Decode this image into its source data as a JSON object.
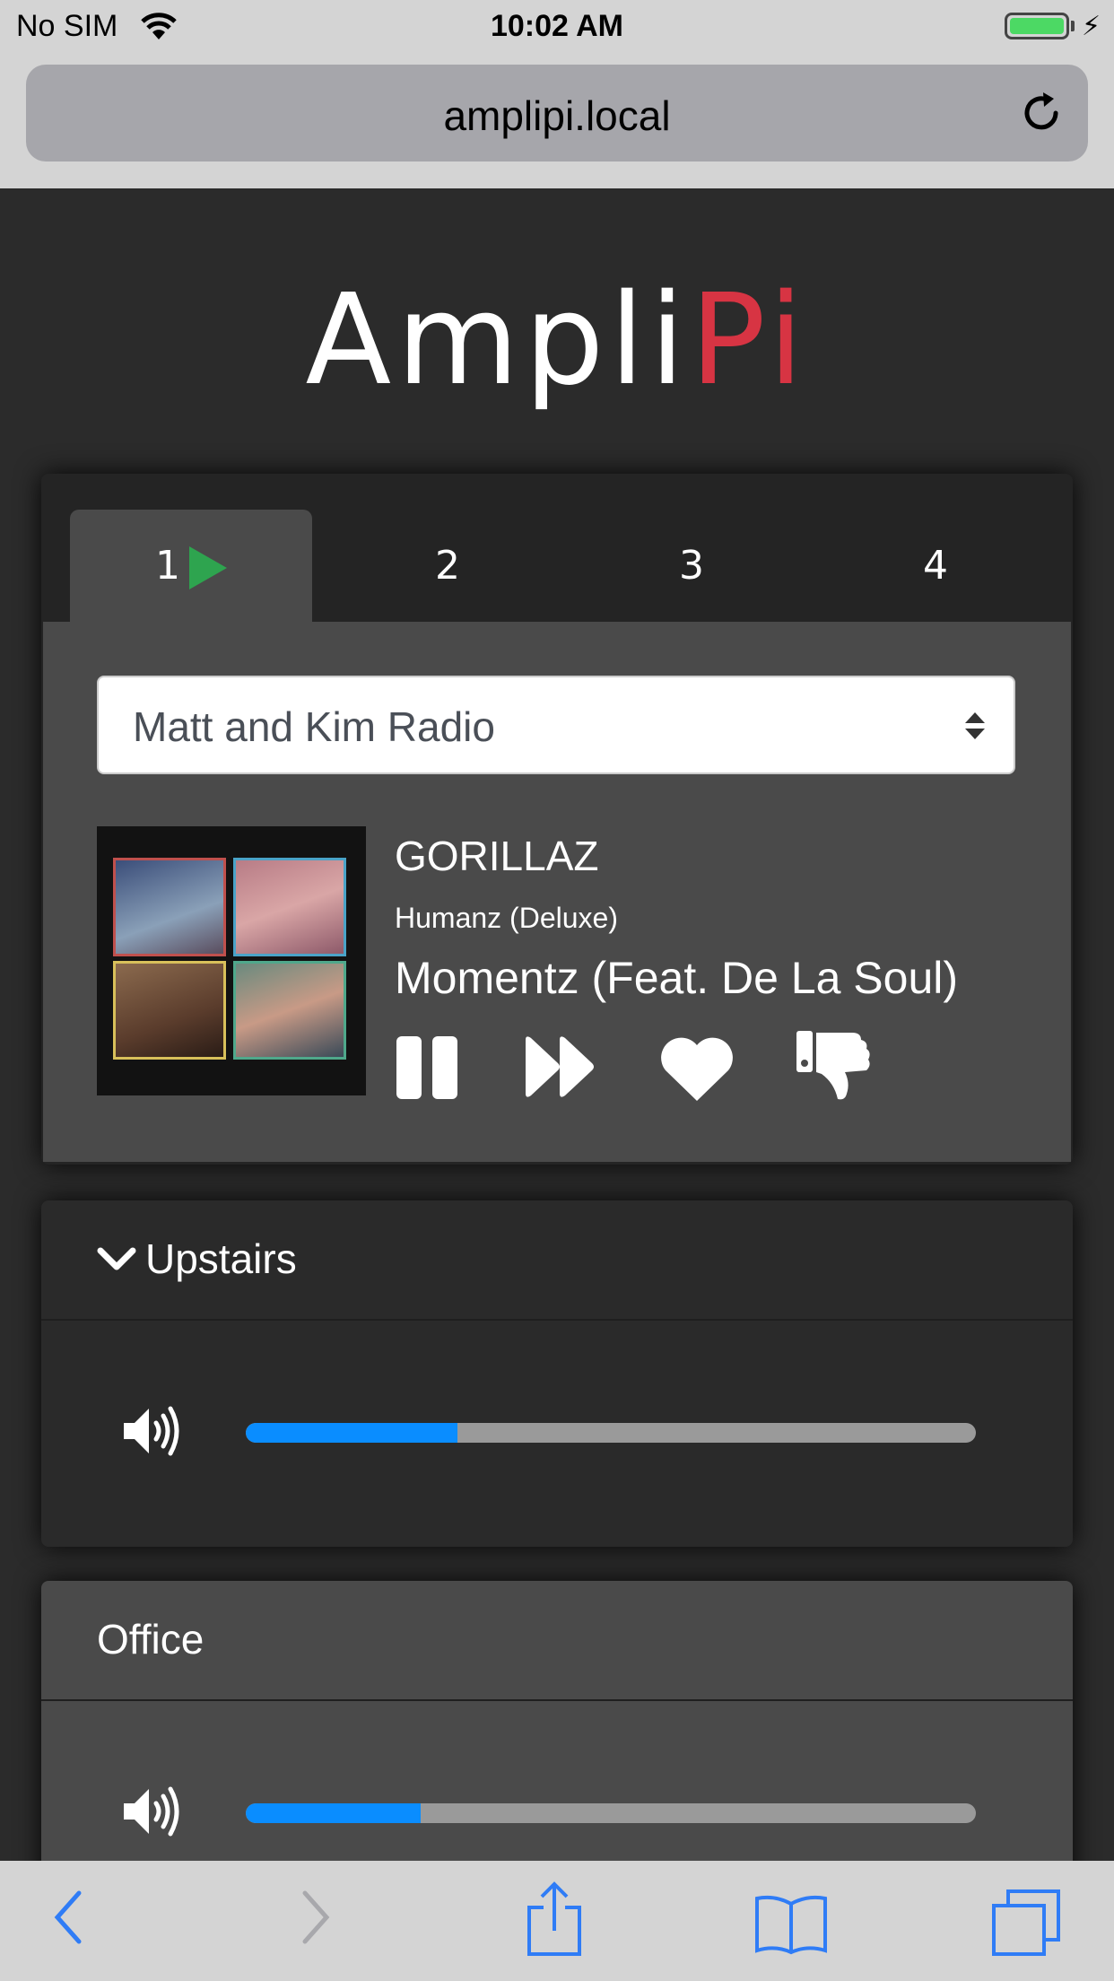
{
  "status_bar": {
    "carrier": "No SIM",
    "time": "10:02 AM",
    "battery_level": 1.0
  },
  "browser": {
    "url": "amplipi.local"
  },
  "logo": {
    "part1": "Ampli",
    "part2": "Pi",
    "accent_color": "#d73443"
  },
  "player": {
    "tabs": [
      {
        "label": "1",
        "active": true,
        "playing": true
      },
      {
        "label": "2",
        "active": false
      },
      {
        "label": "3",
        "active": false
      },
      {
        "label": "4",
        "active": false
      }
    ],
    "source": "Matt and Kim Radio",
    "track": {
      "artist": "GORILLAZ",
      "album": "Humanz (Deluxe)",
      "song": "Momentz (Feat. De La Soul)"
    },
    "controls": [
      "pause-icon",
      "fast-forward-icon",
      "heart-icon",
      "thumbs-down-icon"
    ]
  },
  "zones": [
    {
      "name": "Upstairs",
      "collapsible_chevron": true,
      "volume": 0.29,
      "background": "#2a2a2a"
    },
    {
      "name": "Office",
      "collapsible_chevron": false,
      "volume": 0.24,
      "background": "#4a4a4a"
    }
  ],
  "colors": {
    "volume_fill": "#0a8dff",
    "play_indicator": "#2ea44f",
    "ios_blue": "#2f7cf6"
  }
}
